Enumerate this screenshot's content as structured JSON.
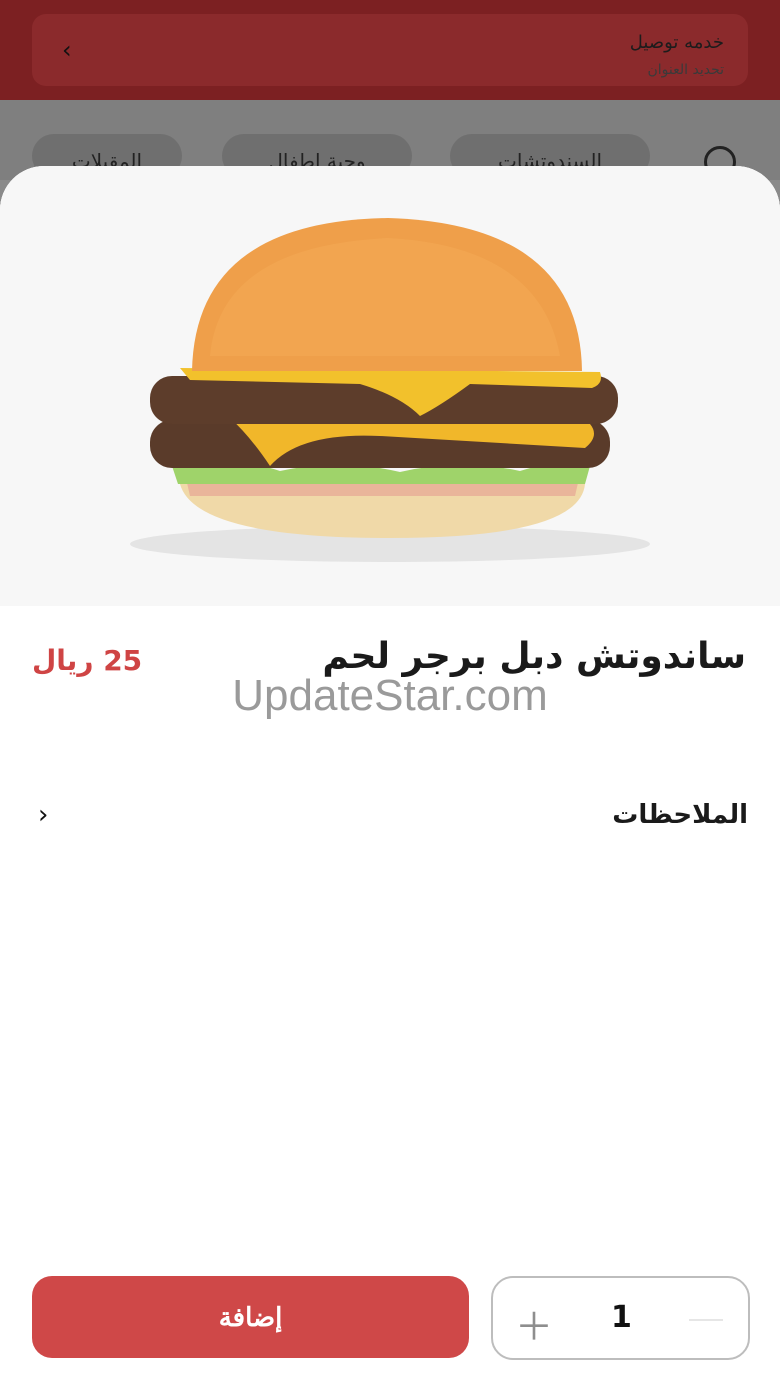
{
  "header": {
    "delivery_title": "خدمه توصيل",
    "delivery_subtitle": "تحديد العنوان"
  },
  "categories": [
    "السندوتشات",
    "وجبة اطفال",
    "المقبلات"
  ],
  "product": {
    "name": "ساندوتش دبل برجر لحم",
    "price": "25 ريال",
    "notes_label": "الملاحظات"
  },
  "watermark": "UpdateStar.com",
  "actions": {
    "add_label": "إضافة",
    "quantity": "1"
  },
  "colors": {
    "accent": "#cf4848",
    "header": "#7c2022"
  }
}
